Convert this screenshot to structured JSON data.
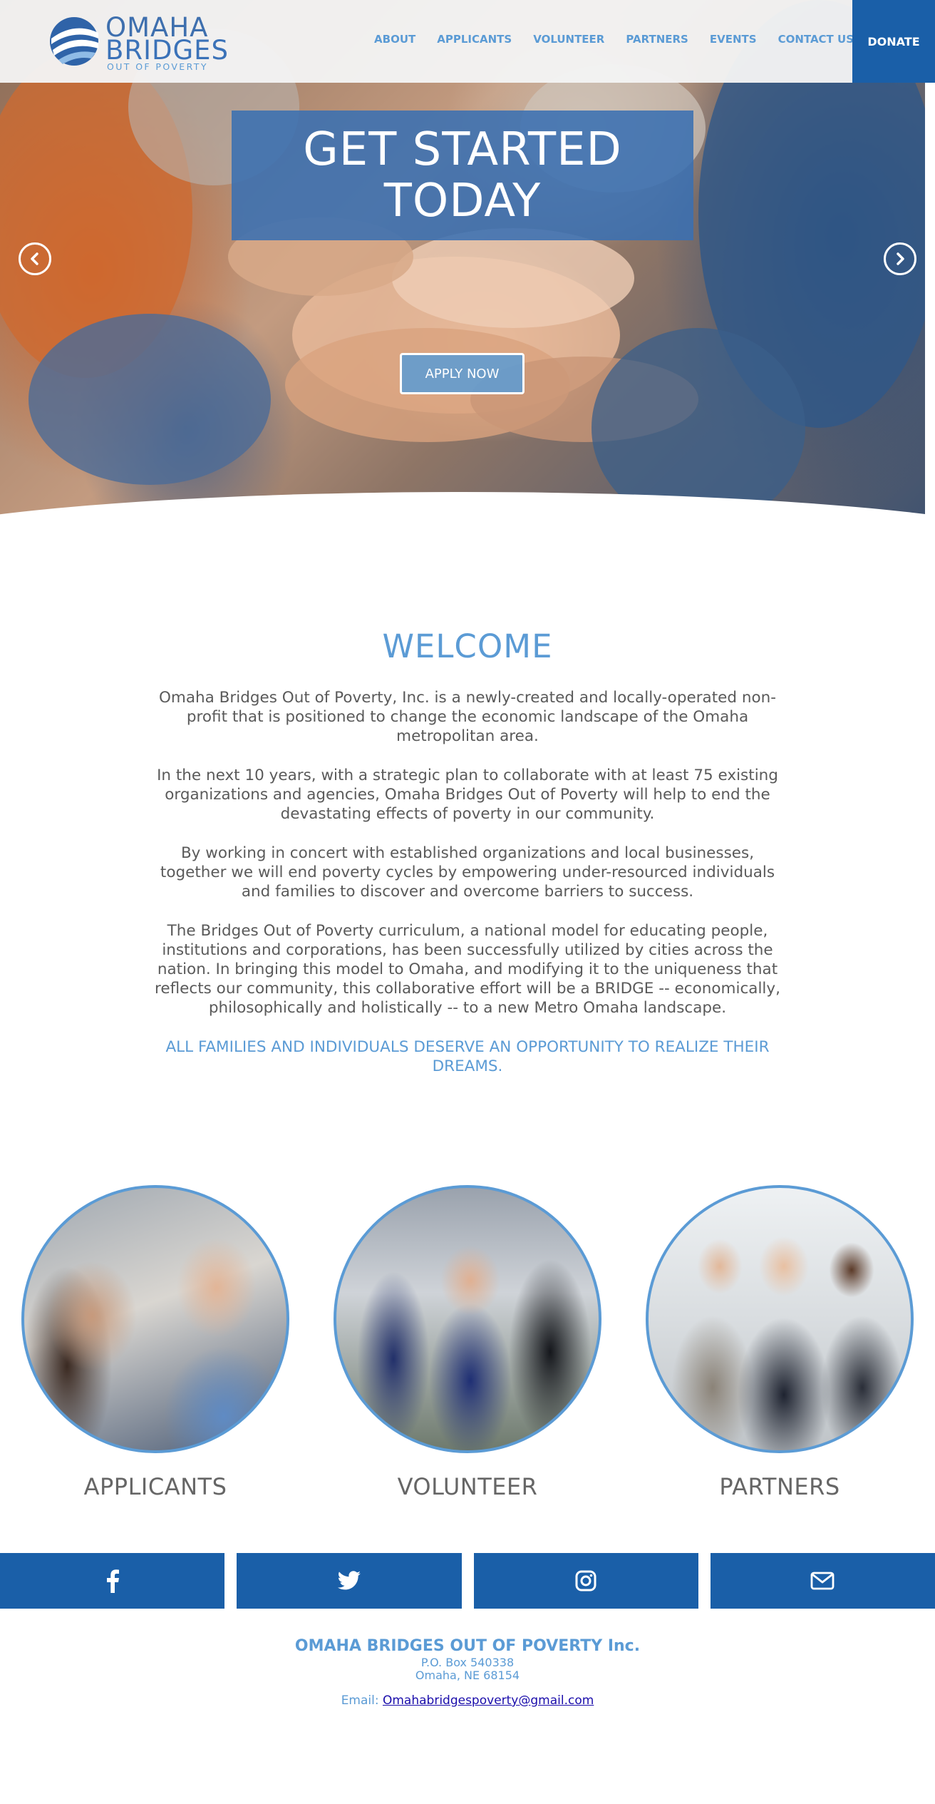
{
  "colors": {
    "brand_blue": "#1a5fa8",
    "accent_blue": "#5b9bd5",
    "text_gray": "#5a5a5a"
  },
  "header": {
    "logo": {
      "line1": "OMAHA",
      "line2": "BRIDGES",
      "line3": "OUT OF POVERTY"
    },
    "nav": [
      "ABOUT",
      "APPLICANTS",
      "VOLUNTEER",
      "PARTNERS",
      "EVENTS",
      "CONTACT US"
    ],
    "donate_label": "DONATE"
  },
  "hero": {
    "title_line1": "GET STARTED",
    "title_line2": "TODAY",
    "apply_label": "APPLY NOW",
    "prev_icon": "chevron-left-icon",
    "next_icon": "chevron-right-icon"
  },
  "welcome": {
    "title": "WELCOME",
    "paragraphs": [
      "Omaha Bridges Out of Poverty, Inc. is a newly-created and locally-operated non-profit that is positioned to change the economic landscape of the Omaha metropolitan area.",
      "In the next 10 years, with a strategic plan to collaborate with at least 75 existing organizations and agencies, Omaha Bridges Out of Poverty will help to end the devastating effects of poverty in our community.",
      "By working in concert with established organizations and local businesses, together we will end poverty cycles by empowering under-resourced individuals and families to discover and overcome barriers to success.",
      "The Bridges Out of Poverty curriculum, a national model for educating people, institutions and corporations, has been successfully utilized by cities across the nation. In bringing this model to Omaha, and modifying it to the uniqueness that reflects our community, this collaborative effort will be a BRIDGE -- economically, philosophically and holistically -- to a new Metro Omaha landscape."
    ],
    "tagline": "ALL FAMILIES AND INDIVIDUALS DESERVE AN OPPORTUNITY TO REALIZE THEIR DREAMS."
  },
  "cards": [
    {
      "label": "APPLICANTS"
    },
    {
      "label": "VOLUNTEER"
    },
    {
      "label": "PARTNERS"
    }
  ],
  "social": [
    {
      "icon": "facebook-icon"
    },
    {
      "icon": "twitter-icon"
    },
    {
      "icon": "instagram-icon"
    },
    {
      "icon": "email-icon"
    }
  ],
  "footer": {
    "org": "OMAHA BRIDGES OUT OF POVERTY Inc.",
    "address1": "P.O. Box 540338",
    "address2": "Omaha, NE 68154",
    "email_label": "Email: ",
    "email": "Omahabridgespoverty@gmail.com"
  }
}
